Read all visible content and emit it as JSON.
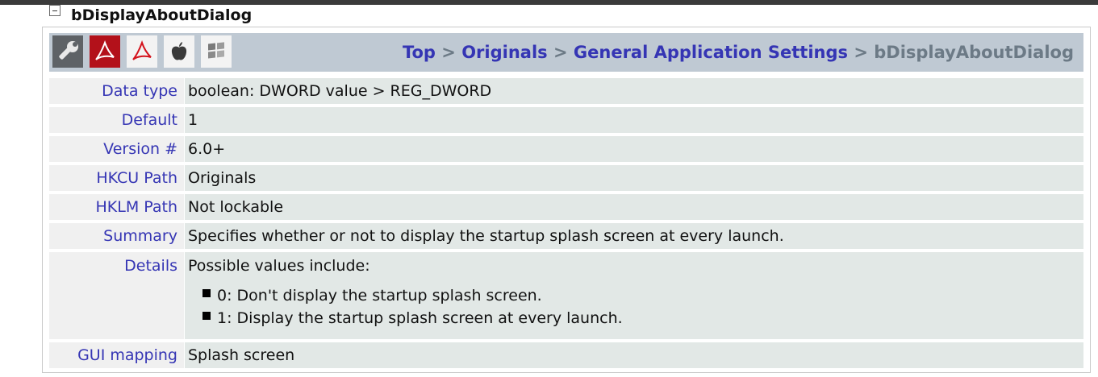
{
  "heading": "bDisplayAboutDialog",
  "toolbar": {
    "icons": [
      "wrench-icon",
      "acrobat-icon",
      "reader-icon",
      "apple-icon",
      "windows-icon"
    ]
  },
  "breadcrumb": {
    "items": [
      "Top",
      "Originals",
      "General Application Settings"
    ],
    "separator": ">",
    "current": "bDisplayAboutDialog"
  },
  "rows": {
    "data_type": {
      "label": "Data type",
      "value": "boolean: DWORD value > REG_DWORD"
    },
    "default": {
      "label": "Default",
      "value": "1"
    },
    "version": {
      "label": "Version #",
      "value": "6.0+"
    },
    "hkcu": {
      "label": "HKCU Path",
      "value": "Originals"
    },
    "hklm": {
      "label": "HKLM Path",
      "value": "Not lockable"
    },
    "summary": {
      "label": "Summary",
      "value": "Specifies whether or not to display the startup splash screen at every launch."
    },
    "details": {
      "label": "Details",
      "intro": "Possible values include:",
      "items": [
        "0: Don't display the startup splash screen.",
        "1: Display the startup splash screen at every launch."
      ]
    },
    "gui": {
      "label": "GUI mapping",
      "value": "Splash screen"
    }
  },
  "colors": {
    "link": "#3535b4",
    "toolbar_bg": "#bfc9d3",
    "label_bg": "#f0f0f0",
    "value_bg": "#e2e8e6",
    "acrobat_red": "#b3111a"
  }
}
